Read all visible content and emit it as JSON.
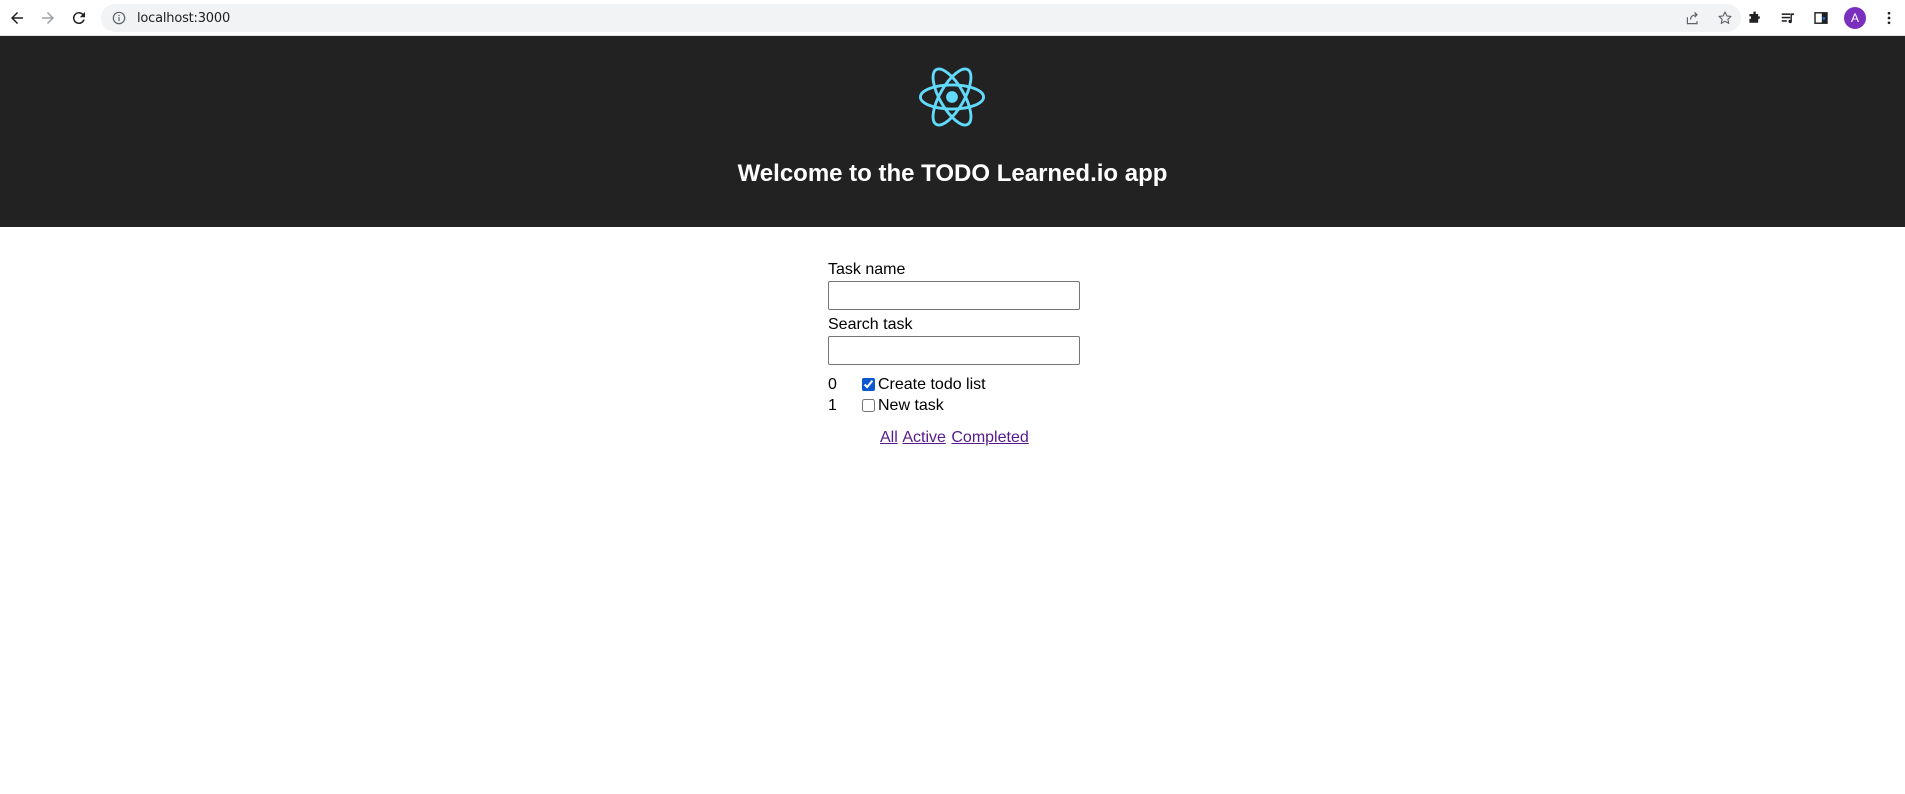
{
  "browser": {
    "url": "localhost:3000",
    "avatar_letter": "A",
    "icons": {
      "back": "arrow-left-icon",
      "forward": "arrow-right-icon",
      "reload": "reload-icon",
      "info": "info-icon",
      "share": "share-icon",
      "bookmark": "star-icon",
      "extensions": "puzzle-icon",
      "media": "media-queue-icon",
      "sidepanel": "side-panel-icon",
      "menu": "kebab-menu-icon"
    }
  },
  "header": {
    "logo": "react-logo",
    "title": "Welcome to the TODO Learned.io app",
    "logo_color": "#61dafb",
    "background": "#222222"
  },
  "form": {
    "task_name_label": "Task name",
    "task_name_value": "",
    "search_label": "Search task",
    "search_value": ""
  },
  "tasks": [
    {
      "index": "0",
      "name": "Create todo list",
      "completed": true
    },
    {
      "index": "1",
      "name": "New task",
      "completed": false
    }
  ],
  "filters": {
    "all": "All",
    "active": "Active",
    "completed": "Completed"
  }
}
